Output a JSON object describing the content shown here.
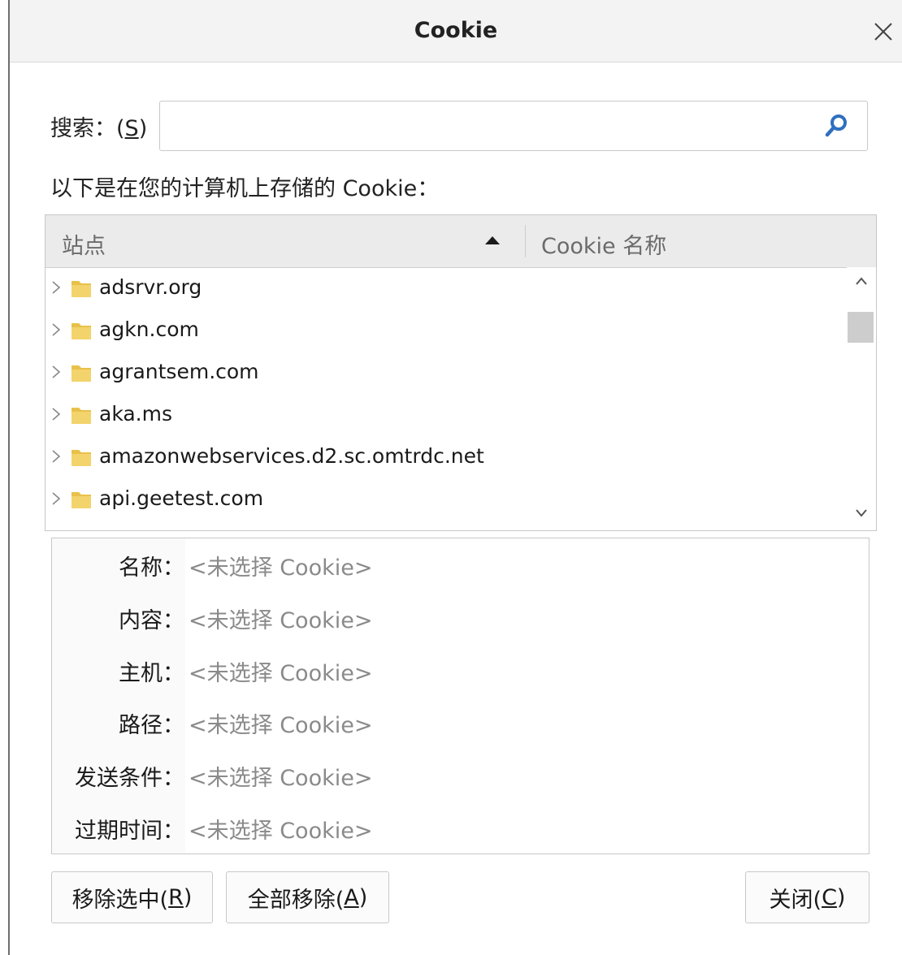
{
  "dialog": {
    "title": "Cookie"
  },
  "search": {
    "label": "搜索：(",
    "accesskey": "S",
    "label_end": ")",
    "value": "",
    "placeholder": ""
  },
  "list_caption": "以下是在您的计算机上存储的 Cookie：",
  "tree": {
    "columns": {
      "site": "站点",
      "cookie_name": "Cookie 名称"
    },
    "sort_direction": "ascending",
    "rows": [
      {
        "label": "adsrvr.org"
      },
      {
        "label": "agkn.com"
      },
      {
        "label": "agrantsem.com"
      },
      {
        "label": "aka.ms"
      },
      {
        "label": "amazonwebservices.d2.sc.omtrdc.net"
      },
      {
        "label": "api.geetest.com"
      }
    ]
  },
  "details": {
    "rows": [
      {
        "label": "名称：",
        "value": "<未选择 Cookie>"
      },
      {
        "label": "内容：",
        "value": "<未选择 Cookie>"
      },
      {
        "label": "主机：",
        "value": "<未选择 Cookie>"
      },
      {
        "label": "路径：",
        "value": "<未选择 Cookie>"
      },
      {
        "label": "发送条件：",
        "value": "<未选择 Cookie>"
      },
      {
        "label": "过期时间：",
        "value": "<未选择 Cookie>"
      }
    ]
  },
  "buttons": {
    "remove_selected": {
      "label": "移除选中(",
      "accesskey": "R",
      "label_end": ")"
    },
    "remove_all": {
      "label": "全部移除(",
      "accesskey": "A",
      "label_end": ")"
    },
    "close": {
      "label": "关闭(",
      "accesskey": "C",
      "label_end": ")"
    }
  },
  "colors": {
    "folder": "#e8c14a",
    "search_icon": "#2f6fbf"
  },
  "icons": [
    "close-icon",
    "search-icon",
    "sort-ascending-icon",
    "twisty-icon",
    "folder-icon",
    "scroll-up-icon",
    "scroll-down-icon"
  ]
}
